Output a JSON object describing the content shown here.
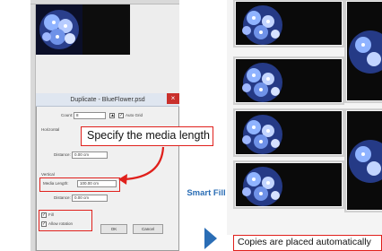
{
  "dialog": {
    "title": "Duplicate - BlueFlower.psd",
    "close_glyph": "×",
    "count_label": "Count:",
    "count_value": "8",
    "auto_grid_label": "Auto Grid",
    "horizontal_label": "Horizontal",
    "distance_label": "Distance:",
    "h_distance_value": "0.00 cm",
    "vertical_label": "Vertical",
    "media_length_label": "Media Length:",
    "media_length_value": "100.00 cm",
    "v_distance_label": "Distance:",
    "v_distance_value": "0.00 cm",
    "fill_label": "Fill",
    "allow_rotation_label": "Allow rotation",
    "ok_label": "OK",
    "cancel_label": "Cancel"
  },
  "callout_text": "Specify the media length",
  "smart_fill_label": "Smart Fill",
  "bottom_caption": "Copies are placed automatically",
  "colors": {
    "accent_red": "#e0201c",
    "arrow_blue": "#2a6db5"
  }
}
